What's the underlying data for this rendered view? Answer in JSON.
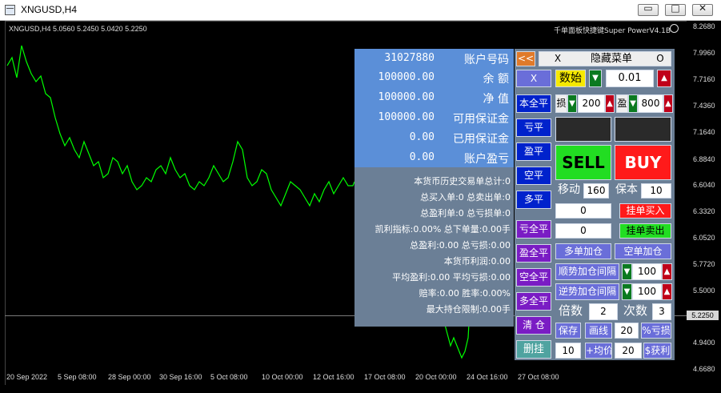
{
  "window": {
    "title": "XNGUSD,H4",
    "minimize": "▭",
    "restore": "□",
    "close": "✕"
  },
  "chart": {
    "symbol_info": "XNGUSD,H4  5.0560 5.2450 5.0420 5.2250",
    "brand": "千单面板快捷键Super PowerV4.1B",
    "current_price": "5.2250",
    "price_ticks": [
      "8.2680",
      "7.9960",
      "7.7160",
      "7.4360",
      "7.1640",
      "6.8840",
      "6.6040",
      "6.3320",
      "6.0520",
      "5.7720",
      "5.5000",
      "4.9400",
      "4.6680"
    ],
    "date_ticks": [
      "20 Sep 2022",
      "5 Sep 08:00",
      "28 Sep 00:00",
      "30 Sep 16:00",
      "5 Oct 08:00",
      "10 Oct 00:00",
      "12 Oct 16:00",
      "17 Oct 08:00",
      "20 Oct 00:00",
      "24 Oct 16:00",
      "27 Oct 08:00"
    ],
    "line_color": "#00ff00"
  },
  "account": [
    {
      "value": "31027880",
      "label": "账户号码"
    },
    {
      "value": "100000.00",
      "label": "余    额"
    },
    {
      "value": "100000.00",
      "label": "净    值"
    },
    {
      "value": "100000.00",
      "label": "可用保证金"
    },
    {
      "value": "0.00",
      "label": "已用保证金"
    },
    {
      "value": "0.00",
      "label": "账户盈亏"
    }
  ],
  "stats": [
    "本货币历史交易单总计:0",
    "总买入单:0  总卖出单:0",
    "总盈利单:0  总亏损单:0",
    "凯利指标:0.00% 总下单量:0.00手",
    "总盈利:0.00  总亏损:0.00",
    "本货币利润:0.00",
    "平均盈利:0.00  平均亏损:0.00",
    "赔率:0.00  胜率:0.00%",
    "最大持仓限制:0.00手"
  ],
  "ctrl": {
    "collapse": "<<",
    "x_top": "X",
    "hide_menu": "隐藏菜单",
    "o_btn": "O",
    "x_btn": "X",
    "open": "数始",
    "lot": "0.01",
    "close_all": "本全平",
    "sl_label": "损",
    "sl_value": "200",
    "tp_label": "盈",
    "tp_value": "800",
    "loss_close": "亏平",
    "profit_close": "盈平",
    "short_close": "空平",
    "long_close": "多平",
    "sell": "SELL",
    "buy": "BUY",
    "move_label": "移动",
    "move_value": "160",
    "breakeven_label": "保本",
    "breakeven_value": "10",
    "pending_buy_value": "0",
    "pending_buy": "挂单买入",
    "pending_sell_value": "0",
    "pending_sell": "挂单卖出",
    "loss_close_all": "亏全平",
    "long_add": "多单加仓",
    "short_add": "空单加仓",
    "profit_close_all": "盈全平",
    "trend_add_gap": "顺势加仓间隔",
    "trend_gap_value": "100",
    "short_close_all": "空全平",
    "counter_add_gap": "逆势加仓间隔",
    "counter_gap_value": "100",
    "long_close_all": "多全平",
    "multiplier_label": "倍数",
    "multiplier_value": "2",
    "times_label": "次数",
    "times_value": "3",
    "clear": "清 仓",
    "save": "保存",
    "draw": "画线",
    "pct_value": "20",
    "pct_loss": "%亏损",
    "delete_pending": "删挂",
    "avg_left_value": "10",
    "avg_price": "+均价",
    "avg_right_value": "20",
    "dollar_profit": "$获利"
  }
}
